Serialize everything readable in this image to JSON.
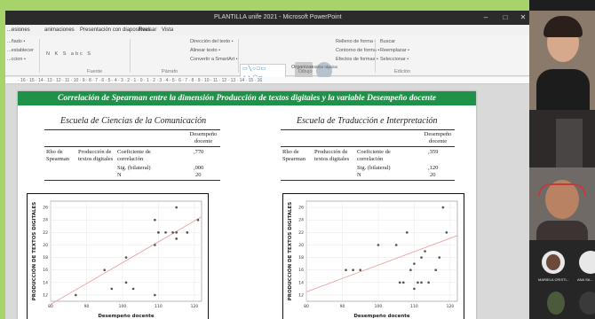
{
  "window": {
    "title": "PLANTILLA  unife 2021  -  Microsoft PowerPoint",
    "minimize": "–",
    "maximize": "□",
    "close": "✕"
  },
  "ribbon_tabs": [
    "...esiones",
    "animaciones",
    "Presentación con diapositivas",
    "Revisar",
    "Vista"
  ],
  "ribbon": {
    "paste_label": "...ñado •",
    "layout_label": "...establecer",
    "section_label": "...ccion •",
    "font_group": "Fuente",
    "paragraph_group": "Párrafo",
    "direction_label": "Dirección del texto •",
    "align_label": "Alinear texto •",
    "smartart_label": "Convertir a SmartArt •",
    "arrange_label": "Organizar",
    "quick_styles_label": "Estilos rápidos",
    "fill_label": "Relleno de forma •",
    "outline_label": "Contorno de forma •",
    "effects_label": "Efectos de formas •",
    "drawing_group": "Dibujo",
    "find_label": "Buscar",
    "replace_label": "Reemplazar •",
    "select_label": "Seleccionar •",
    "editing_group": "Edición"
  },
  "ruler_text": "· 16 · 15 · 14 · 13 · 12 · 11 · 10 · 9 · 8 · 7 · 6 · 5 · 4 · 3 · 2 · 1 · 0 · 1 · 2 · 3 · 4 · 5 · 6 · 7 · 8 · 9 · 10 · 11 · 12 · 13 · 14 · 15 · 16",
  "slide": {
    "banner": "Correlación de Spearman entre la dimensión Producción de textos digitales y la variable Desempeño docente",
    "left": {
      "school": "Escuela de Ciencias de la Comunicación",
      "header": "Desempeño docente",
      "row_label": "Rho de Spearman",
      "row_var": "Producción de textos digitales",
      "stats": [
        "Coeficiente de correlación",
        "Sig. (bilateral)",
        "N"
      ],
      "values": [
        ",770",
        ",000",
        "20"
      ]
    },
    "right": {
      "school": "Escuela de Traducción e Interpretación",
      "header": "Desempeño docente",
      "row_label": "Rho de Spearman",
      "row_var": "Producción de textos digitales",
      "stats": [
        "Coeficiente de correlación",
        "Sig. (bilateral)",
        "N"
      ],
      "values": [
        ",359",
        ",120",
        "20"
      ]
    }
  },
  "participants": {
    "p4_name": "MARIELA CRISTI...",
    "p5_name": "ANA SA..."
  },
  "colors": {
    "banner": "#1f9249",
    "frame": "#a6d36a",
    "trendline": "#e8a3a3",
    "points": "#555555"
  },
  "chart_data": [
    {
      "type": "scatter",
      "title": "",
      "xlabel": "Desempeño docente",
      "ylabel": "PRODUCCIÓN DE TEXTOS DIGITALES",
      "xlim": [
        80,
        122
      ],
      "ylim": [
        11,
        27
      ],
      "xticks": [
        80,
        90,
        100,
        110,
        120
      ],
      "yticks": [
        12,
        14,
        16,
        18,
        20,
        22,
        24,
        26
      ],
      "points": [
        [
          87,
          12
        ],
        [
          95,
          16
        ],
        [
          97,
          13
        ],
        [
          101,
          18
        ],
        [
          101,
          14
        ],
        [
          103,
          13
        ],
        [
          109,
          24
        ],
        [
          109,
          20
        ],
        [
          109,
          12
        ],
        [
          110,
          22
        ],
        [
          110,
          22
        ],
        [
          112,
          22
        ],
        [
          114,
          22
        ],
        [
          115,
          21
        ],
        [
          115,
          21
        ],
        [
          115,
          26
        ],
        [
          115,
          22
        ],
        [
          118,
          22
        ],
        [
          118,
          22
        ],
        [
          121,
          24
        ]
      ],
      "trendline": [
        [
          80,
          10.5
        ],
        [
          122,
          24.5
        ]
      ]
    },
    {
      "type": "scatter",
      "title": "",
      "xlabel": "Desempeño docente",
      "ylabel": "PRODUCCIÓN DE TEXTOS DIGITALES",
      "xlim": [
        80,
        122
      ],
      "ylim": [
        11,
        27
      ],
      "xticks": [
        80,
        90,
        100,
        110,
        120
      ],
      "yticks": [
        12,
        14,
        16,
        18,
        20,
        22,
        24,
        26
      ],
      "points": [
        [
          91,
          16
        ],
        [
          93,
          16
        ],
        [
          95,
          16
        ],
        [
          100,
          20
        ],
        [
          105,
          20
        ],
        [
          106,
          14
        ],
        [
          107,
          14
        ],
        [
          108,
          22
        ],
        [
          109,
          16
        ],
        [
          110,
          13
        ],
        [
          110,
          17
        ],
        [
          111,
          14
        ],
        [
          112,
          14
        ],
        [
          112,
          18
        ],
        [
          113,
          19
        ],
        [
          114,
          14
        ],
        [
          116,
          16
        ],
        [
          117,
          18
        ],
        [
          118,
          26
        ],
        [
          119,
          22
        ]
      ],
      "trendline": [
        [
          80,
          12.5
        ],
        [
          122,
          21.5
        ]
      ]
    }
  ]
}
